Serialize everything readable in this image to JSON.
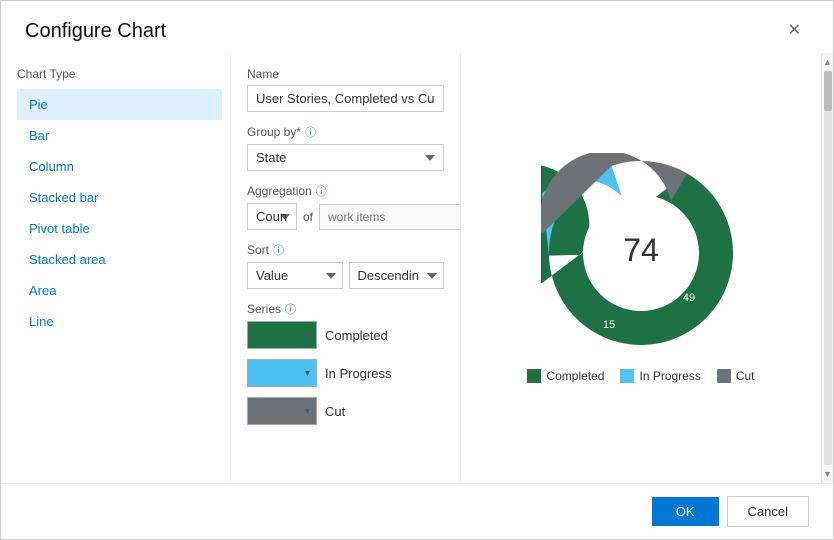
{
  "dialog": {
    "title": "Configure Chart",
    "close_label": "✕"
  },
  "chartTypePanel": {
    "label": "Chart Type",
    "items": [
      {
        "id": "pie",
        "label": "Pie",
        "selected": true
      },
      {
        "id": "bar",
        "label": "Bar",
        "selected": false
      },
      {
        "id": "column",
        "label": "Column",
        "selected": false
      },
      {
        "id": "stacked-bar",
        "label": "Stacked bar",
        "selected": false
      },
      {
        "id": "pivot-table",
        "label": "Pivot table",
        "selected": false
      },
      {
        "id": "stacked-area",
        "label": "Stacked area",
        "selected": false
      },
      {
        "id": "area",
        "label": "Area",
        "selected": false
      },
      {
        "id": "line",
        "label": "Line",
        "selected": false
      }
    ]
  },
  "configPanel": {
    "nameLabel": "Name",
    "nameValue": "User Stories, Completed vs Cut",
    "groupByLabel": "Group by*",
    "groupByValue": "State",
    "aggregationLabel": "Aggregation",
    "aggregationValue": "Coun",
    "aggregationOfLabel": "of",
    "aggregationPlaceholder": "work items",
    "sortLabel": "Sort",
    "sortValueLabel": "Value",
    "sortDirectionLabel": "Descendin",
    "seriesLabel": "Series",
    "series": [
      {
        "id": "completed",
        "label": "Completed",
        "color": "#1e7145"
      },
      {
        "id": "in-progress",
        "label": "In Progress",
        "color": "#4ec2f0"
      },
      {
        "id": "cut",
        "label": "Cut",
        "color": "#6d7278"
      }
    ]
  },
  "chart": {
    "centerValue": "74",
    "segments": [
      {
        "label": "Completed",
        "value": 49,
        "color": "#1e7145",
        "percent": 66.2
      },
      {
        "label": "In Progress",
        "value": 15,
        "color": "#4ec2f0",
        "percent": 20.3
      },
      {
        "label": "Cut",
        "value": 10,
        "color": "#6d7278",
        "percent": 13.5
      }
    ],
    "legend": [
      {
        "label": "Completed",
        "color": "#1e7145"
      },
      {
        "label": "In Progress",
        "color": "#4ec2f0"
      },
      {
        "label": "Cut",
        "color": "#6d7278"
      }
    ]
  },
  "footer": {
    "ok_label": "OK",
    "cancel_label": "Cancel"
  }
}
